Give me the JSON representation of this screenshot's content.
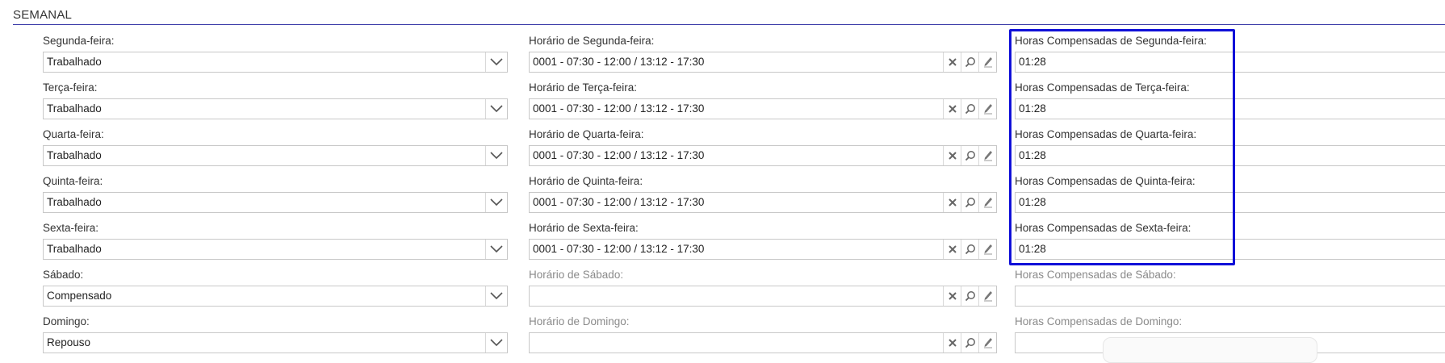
{
  "section": {
    "title": "SEMANAL"
  },
  "days": [
    {
      "day_label": "Segunda-feira:",
      "day_value": "Trabalhado",
      "schedule_label": "Horário de Segunda-feira:",
      "schedule_value": "0001 - 07:30 - 12:00 / 13:12 - 17:30",
      "comp_label": "Horas Compensadas de Segunda-feira:",
      "comp_value": "01:28"
    },
    {
      "day_label": "Terça-feira:",
      "day_value": "Trabalhado",
      "schedule_label": "Horário de Terça-feira:",
      "schedule_value": "0001 - 07:30 - 12:00 / 13:12 - 17:30",
      "comp_label": "Horas Compensadas de Terça-feira:",
      "comp_value": "01:28"
    },
    {
      "day_label": "Quarta-feira:",
      "day_value": "Trabalhado",
      "schedule_label": "Horário de Quarta-feira:",
      "schedule_value": "0001 - 07:30 - 12:00 / 13:12 - 17:30",
      "comp_label": "Horas Compensadas de Quarta-feira:",
      "comp_value": "01:28"
    },
    {
      "day_label": "Quinta-feira:",
      "day_value": "Trabalhado",
      "schedule_label": "Horário de Quinta-feira:",
      "schedule_value": "0001 - 07:30 - 12:00 / 13:12 - 17:30",
      "comp_label": "Horas Compensadas de Quinta-feira:",
      "comp_value": "01:28"
    },
    {
      "day_label": "Sexta-feira:",
      "day_value": "Trabalhado",
      "schedule_label": "Horário de Sexta-feira:",
      "schedule_value": "0001 - 07:30 - 12:00 / 13:12 - 17:30",
      "comp_label": "Horas Compensadas de Sexta-feira:",
      "comp_value": "01:28"
    },
    {
      "day_label": "Sábado:",
      "day_value": "Compensado",
      "schedule_label": "Horário de Sábado:",
      "schedule_value": "",
      "comp_label": "Horas Compensadas de Sábado:",
      "comp_value": ""
    },
    {
      "day_label": "Domingo:",
      "day_value": "Repouso",
      "schedule_label": "Horário de Domingo:",
      "schedule_value": "",
      "comp_label": "Horas Compensadas de Domingo:",
      "comp_value": ""
    }
  ],
  "icons": {
    "select": "chevron-down-icon",
    "clear": "close-icon",
    "search": "search-icon",
    "edit": "pencil-icon"
  },
  "colors": {
    "highlight_border": "#1010d8",
    "section_rule": "#3a3aa8",
    "disabled_label": "#8a8a8a"
  }
}
